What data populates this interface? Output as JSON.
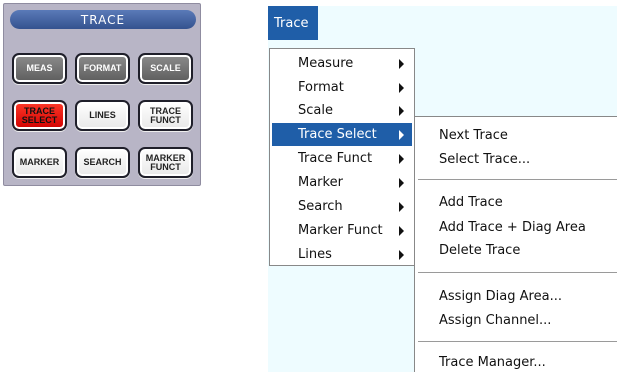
{
  "hardkey_panel": {
    "title": "TRACE",
    "buttons": [
      {
        "label": "MEAS",
        "style": "dark"
      },
      {
        "label": "FORMAT",
        "style": "dark"
      },
      {
        "label": "SCALE",
        "style": "dark"
      },
      {
        "label": "TRACE\nSELECT",
        "style": "red"
      },
      {
        "label": "LINES",
        "style": "light"
      },
      {
        "label": "TRACE\nFUNCT",
        "style": "light"
      },
      {
        "label": "MARKER",
        "style": "light"
      },
      {
        "label": "SEARCH",
        "style": "light"
      },
      {
        "label": "MARKER\nFUNCT",
        "style": "light"
      }
    ]
  },
  "menubar": {
    "active_menu": "Trace"
  },
  "trace_menu": {
    "items": [
      {
        "label": "Measure",
        "has_submenu": true
      },
      {
        "label": "Format",
        "has_submenu": true
      },
      {
        "label": "Scale",
        "has_submenu": true
      },
      {
        "label": "Trace Select",
        "has_submenu": true,
        "highlighted": true
      },
      {
        "label": "Trace Funct",
        "has_submenu": true
      },
      {
        "label": "Marker",
        "has_submenu": true
      },
      {
        "label": "Search",
        "has_submenu": true
      },
      {
        "label": "Marker Funct",
        "has_submenu": true
      },
      {
        "label": "Lines",
        "has_submenu": true
      }
    ]
  },
  "trace_select_submenu": {
    "items": [
      {
        "label": "Next Trace"
      },
      {
        "label": "Select Trace..."
      },
      {
        "label": "Add Trace"
      },
      {
        "label": "Add Trace + Diag Area"
      },
      {
        "label": "Delete Trace"
      },
      {
        "label": "Assign Diag Area..."
      },
      {
        "label": "Assign Channel..."
      },
      {
        "label": "Trace Manager..."
      }
    ]
  },
  "colors": {
    "highlight": "#1f5ea8",
    "workarea_background": "#eefcff",
    "panel_background": "#b8b5c6",
    "active_hardkey": "#ff2a1a"
  }
}
